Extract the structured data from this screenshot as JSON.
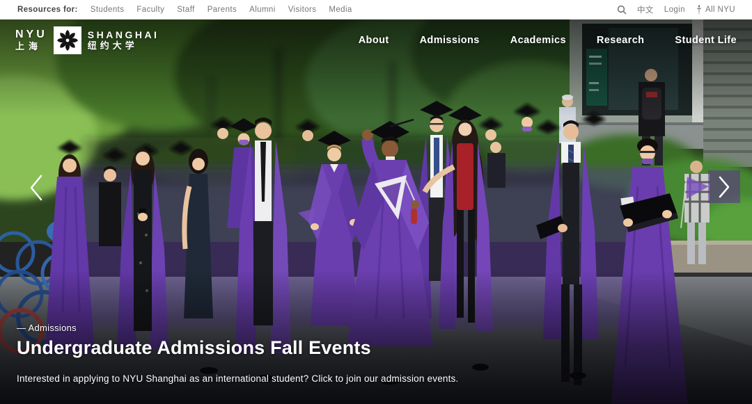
{
  "utility_bar": {
    "label": "Resources for:",
    "links": [
      "Students",
      "Faculty",
      "Staff",
      "Parents",
      "Alumni",
      "Visitors",
      "Media"
    ],
    "language_toggle": "中文",
    "login_label": "Login",
    "all_nyu_label": "All NYU"
  },
  "logo": {
    "line1_en": "NYU",
    "line1_cn": "上海",
    "line2_en": "SHANGHAI",
    "line2_cn": "纽约大学"
  },
  "nav": {
    "items": [
      "About",
      "Admissions",
      "Academics",
      "Research",
      "Student Life"
    ]
  },
  "hero": {
    "breadcrumb": "— Admissions",
    "title": "Undergraduate Admissions Fall Events",
    "subtitle": "Interested in applying to NYU Shanghai as an international student? Click to join our admission events.",
    "image_description": "Graduates in purple gowns and black mortarboards walking in a procession outdoors"
  },
  "icons": {
    "search": "magnifying-glass",
    "all_nyu_torch": "nyu-torch",
    "logo_emblem": "pinwheel-flower",
    "carousel_prev": "chevron-left",
    "carousel_next": "chevron-right"
  },
  "colors": {
    "nyu_purple": "#57068c",
    "gown_purple": "#6b3fae",
    "utility_text": "#767676",
    "hero_text": "#ffffff",
    "arrow_box": "rgba(94,45,146,0.55)"
  }
}
